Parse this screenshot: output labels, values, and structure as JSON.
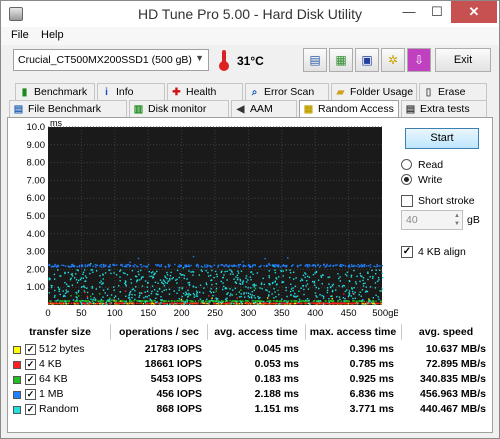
{
  "window": {
    "title": "HD Tune Pro 5.00 - Hard Disk Utility",
    "minimize": "—",
    "maximize": "☐",
    "close": "✕"
  },
  "menu": {
    "file": "File",
    "help": "Help"
  },
  "toolbar": {
    "drive": "Crucial_CT500MX200SSD1 (500 gB)",
    "temperature": "31°C",
    "exit": "Exit"
  },
  "tabs_top": [
    "Benchmark",
    "Info",
    "Health",
    "Error Scan",
    "Folder Usage",
    "Erase"
  ],
  "tabs_bottom": [
    "File Benchmark",
    "Disk monitor",
    "AAM",
    "Random Access",
    "Extra tests"
  ],
  "active_tab": "Random Access",
  "controls": {
    "start": "Start",
    "read": "Read",
    "write": "Write",
    "mode_selected": "Write",
    "short_stroke": "Short stroke",
    "short_stroke_checked": false,
    "stroke_value": "40",
    "stroke_unit": "gB",
    "align": "4 KB align",
    "align_checked": true
  },
  "chart_data": {
    "type": "scatter",
    "y_unit": "ms",
    "x_unit": "gB",
    "ylim": [
      0,
      10
    ],
    "xlim": [
      0,
      500
    ],
    "y_ticks": [
      "1.00",
      "2.00",
      "3.00",
      "4.00",
      "5.00",
      "6.00",
      "7.00",
      "8.00",
      "9.00",
      "10.0"
    ],
    "x_ticks": [
      "0",
      "50",
      "100",
      "150",
      "200",
      "250",
      "300",
      "350",
      "400",
      "450",
      "500gB"
    ],
    "background": "#1a1a1a",
    "series": [
      {
        "name": "512 bytes",
        "color": "#ffff00",
        "avg_ms": 0.045,
        "max_ms": 0.396
      },
      {
        "name": "4 KB",
        "color": "#ff2020",
        "avg_ms": 0.053,
        "max_ms": 0.785
      },
      {
        "name": "64 KB",
        "color": "#20c020",
        "avg_ms": 0.183,
        "max_ms": 0.925
      },
      {
        "name": "1 MB",
        "color": "#2080ff",
        "avg_ms": 2.188,
        "max_ms": 6.836
      },
      {
        "name": "Random",
        "color": "#20e0e0",
        "avg_ms": 1.151,
        "max_ms": 3.771
      }
    ]
  },
  "table": {
    "headers": [
      "transfer size",
      "operations / sec",
      "avg. access time",
      "max. access time",
      "avg. speed"
    ],
    "rows": [
      {
        "name": "512 bytes",
        "color": "#ffff00",
        "ops": "21783 IOPS",
        "avg": "0.045 ms",
        "max": "0.396 ms",
        "speed": "10.637 MB/s"
      },
      {
        "name": "4 KB",
        "color": "#ff2020",
        "ops": "18661 IOPS",
        "avg": "0.053 ms",
        "max": "0.785 ms",
        "speed": "72.895 MB/s"
      },
      {
        "name": "64 KB",
        "color": "#20c020",
        "ops": "5453 IOPS",
        "avg": "0.183 ms",
        "max": "0.925 ms",
        "speed": "340.835 MB/s"
      },
      {
        "name": "1 MB",
        "color": "#2080ff",
        "ops": "456 IOPS",
        "avg": "2.188 ms",
        "max": "6.836 ms",
        "speed": "456.963 MB/s"
      },
      {
        "name": "Random",
        "color": "#20e0e0",
        "ops": "868 IOPS",
        "avg": "1.151 ms",
        "max": "3.771 ms",
        "speed": "440.467 MB/s"
      }
    ]
  }
}
